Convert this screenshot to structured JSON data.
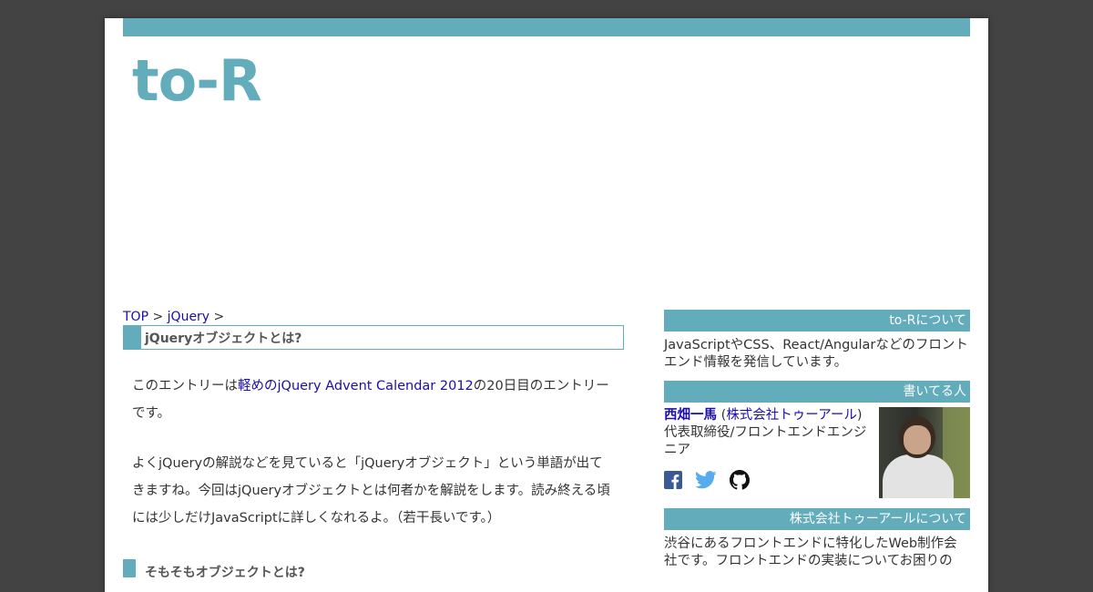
{
  "site": {
    "logo": "to-R",
    "brand_color": "#62acbb",
    "link_color": "#1a0dab"
  },
  "breadcrumb": {
    "top": "TOP",
    "sep1": " > ",
    "category": "jQuery",
    "sep2": " >"
  },
  "article": {
    "title": "jQueryオブジェクトとは?",
    "p1_before": "このエントリーは",
    "p1_link": "軽めのjQuery Advent Calendar 2012",
    "p1_after": "の20日目のエントリーです。",
    "p2": "よくjQueryの解説などを見ていると「jQueryオブジェクト」という単語が出てきますね。今回はjQueryオブジェクトとは何者かを解説をします。読み終える頃には少しだけJavaScriptに詳しくなれるよ。（若干長いです。）",
    "h2": "そもそもオブジェクトとは?"
  },
  "sidebar": {
    "about_head": "to-Rについて",
    "about_text": "JavaScriptやCSS、React/Angularなどのフロントエンド情報を発信しています。",
    "author_head": "書いてる人",
    "author_name": "西畑一馬",
    "author_company": "株式会社トゥーアール",
    "author_role": "代表取締役/フロントエンドエンジニア",
    "company_head": "株式会社トゥーアールについて",
    "company_text": "渋谷にあるフロントエンドに特化したWeb制作会社です。フロントエンドの実装についてお困りの"
  },
  "social_icons": [
    "facebook-icon",
    "twitter-icon",
    "github-icon"
  ]
}
